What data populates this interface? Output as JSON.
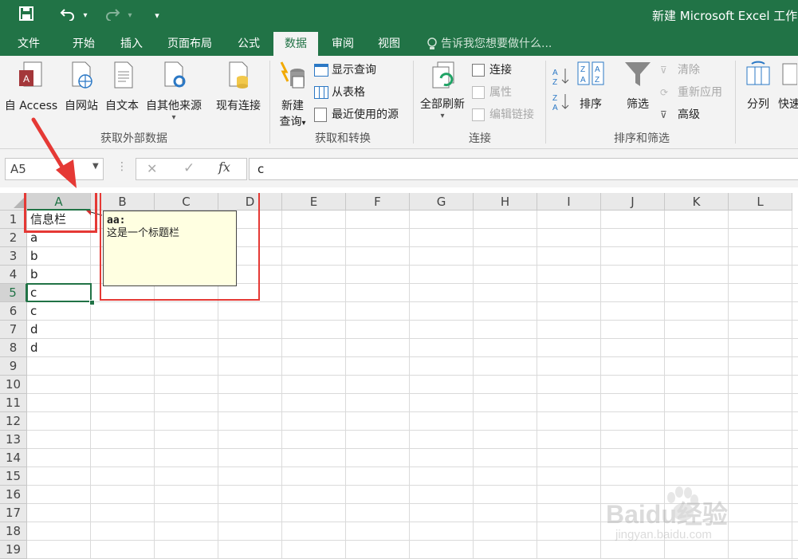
{
  "window": {
    "title": "新建 Microsoft Excel 工作"
  },
  "qat": {
    "save_icon": "save-icon",
    "undo_icon": "undo-icon",
    "redo_icon": "redo-icon",
    "customize_icon": "customize-icon"
  },
  "tabs": [
    "文件",
    "开始",
    "插入",
    "页面布局",
    "公式",
    "数据",
    "审阅",
    "视图"
  ],
  "active_tab": "数据",
  "tell_me": "告诉我您想要做什么...",
  "ribbon": {
    "get_external": {
      "label": "获取外部数据",
      "access": "自 Access",
      "web": "自网站",
      "text": "自文本",
      "other": "自其他来源",
      "existing": "现有连接"
    },
    "get_transform": {
      "label": "获取和转换",
      "new_query_1": "新建",
      "new_query_2": "查询",
      "show_queries": "显示查询",
      "from_table": "从表格",
      "recent_sources": "最近使用的源"
    },
    "connections": {
      "label": "连接",
      "refresh_all": "全部刷新",
      "connections": "连接",
      "properties": "属性",
      "edit_links": "编辑链接"
    },
    "sort_filter": {
      "label": "排序和筛选",
      "sort": "排序",
      "filter": "筛选",
      "clear": "清除",
      "reapply": "重新应用",
      "advanced": "高级"
    },
    "data_tools": {
      "text_to_columns": "分列",
      "flash_fill": "快速"
    }
  },
  "formula_bar": {
    "name_box": "A5",
    "cancel": "✕",
    "enter": "✓",
    "fx": "fx",
    "value": "c"
  },
  "columns": [
    "A",
    "B",
    "C",
    "D",
    "E",
    "F",
    "G",
    "H",
    "I",
    "J",
    "K",
    "L"
  ],
  "rows": [
    "1",
    "2",
    "3",
    "4",
    "5",
    "6",
    "7",
    "8",
    "9",
    "10",
    "11",
    "12",
    "13",
    "14",
    "15",
    "16",
    "17",
    "18",
    "19"
  ],
  "cells": {
    "A1": "信息栏",
    "A2": "a",
    "A3": "b",
    "A4": "b",
    "A5": "c",
    "A6": "c",
    "A7": "d",
    "A8": "d"
  },
  "selected_cell": "A5",
  "comment": {
    "author": "aa:",
    "text": "这是一个标题栏"
  },
  "watermark": {
    "line1": "Baidu经验",
    "line2": "jingyan.baidu.com"
  },
  "colors": {
    "accent": "#217346",
    "highlight_box": "#e53935",
    "comment_bg": "#ffffe1"
  }
}
